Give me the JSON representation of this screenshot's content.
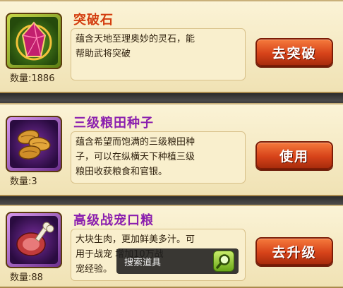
{
  "items": [
    {
      "name": "突破石",
      "name_color": "#d23c10",
      "desc_lines": [
        "蕴含天地至理奥妙的灵石，能",
        "帮助武将突破"
      ],
      "qty_label": "数量:",
      "qty": "1886",
      "button": "去突破",
      "icon": "purple-crystal-icon"
    },
    {
      "name": "三级粮田种子",
      "name_color": "#8a1fb0",
      "desc_lines": [
        "蕴含希望而饱满的三级粮田种",
        "子，可以在纵横天下种植三级",
        "粮田收获粮食和官银。"
      ],
      "qty_label": "数量:",
      "qty": "3",
      "button": "使用",
      "icon": "seed-icon"
    },
    {
      "name": "高级战宠口粮",
      "name_color": "#8a1fb0",
      "desc_lines": [
        "大块生肉，更加鲜美多汁。可",
        "用于战宠           增加10万战",
        "宠经验。"
      ],
      "qty_label": "数量:",
      "qty": "88",
      "button": "去升级",
      "icon": "meat-icon"
    }
  ],
  "search": {
    "label": "搜索道具",
    "icon": "search-icon"
  }
}
